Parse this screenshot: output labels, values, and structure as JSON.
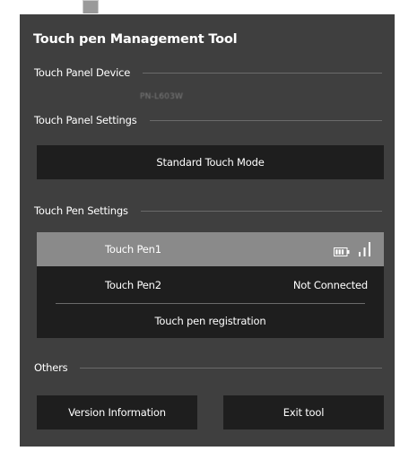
{
  "window": {
    "title": "Touch pen Management Tool"
  },
  "sections": {
    "device": "Touch Panel Device",
    "panel_settings": "Touch Panel Settings",
    "pen_settings": "Touch Pen Settings",
    "others": "Others"
  },
  "device": {
    "model": "PN-L603W"
  },
  "panel": {
    "mode_button": "Standard Touch Mode"
  },
  "pens": [
    {
      "name": "Touch Pen1",
      "status": "",
      "selected": true,
      "battery_icon": "battery-icon",
      "signal_icon": "signal-strength-icon"
    },
    {
      "name": "Touch Pen2",
      "status": "Not Connected",
      "selected": false
    }
  ],
  "registration": {
    "label": "Touch pen registration"
  },
  "footer": {
    "version_button": "Version Information",
    "exit_button": "Exit tool"
  },
  "colors": {
    "window_bg": "#3f3f3f",
    "button_bg": "#1e1e1e",
    "selected_row": "#8a8a8a",
    "text": "#ffffff"
  }
}
